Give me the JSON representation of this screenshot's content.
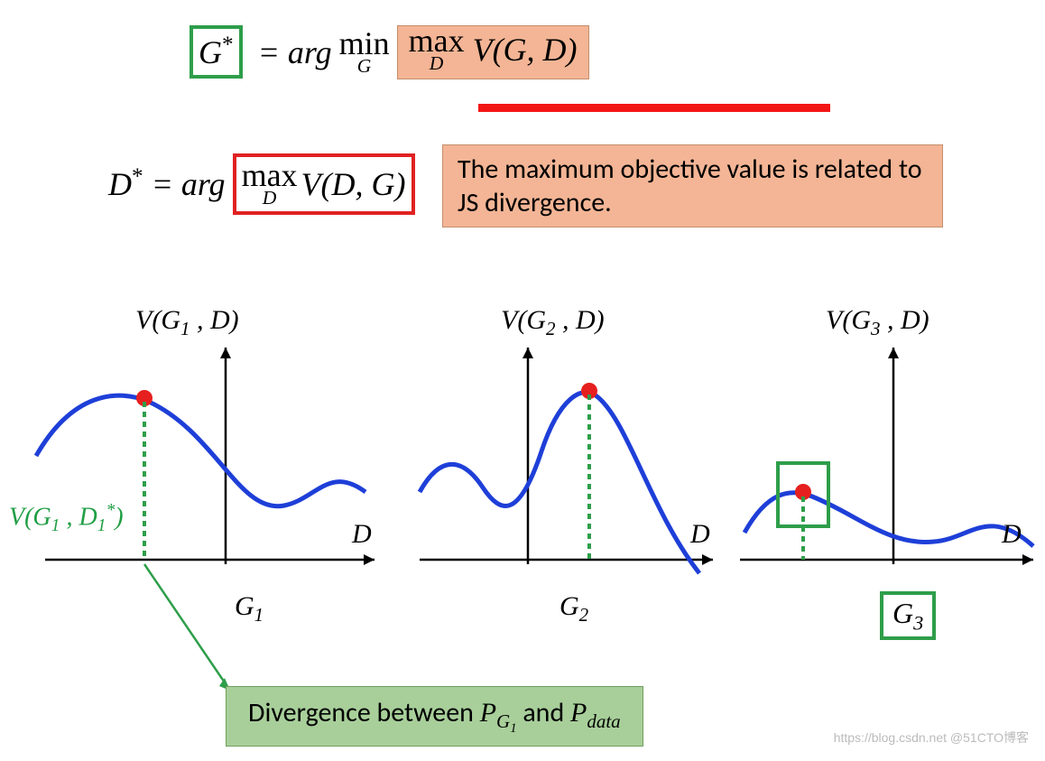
{
  "eq1": {
    "g_star": "G*",
    "eq": "= arg",
    "min_op": "min",
    "min_sub": "G",
    "max_op": "max",
    "max_sub": "D",
    "vgd": "V(G, D)"
  },
  "eq2": {
    "d_star": "D* = arg",
    "max_op": "max",
    "max_sub": "D",
    "vdg": "V(D, G)"
  },
  "note": "The maximum objective value is related to JS divergence.",
  "plots": {
    "p1_title": "V(G₁ , D)",
    "p2_title": "V(G₂ , D)",
    "p3_title": "V(G₃ , D)",
    "x_axis": "D",
    "g1": "G₁",
    "g2": "G₂",
    "g3": "G₃"
  },
  "side_label": "V(G₁ , D₁*)",
  "divergence": "Divergence between P_{G₁} and P_{data}",
  "watermark": "https://blog.csdn.net @51CTO博客"
}
